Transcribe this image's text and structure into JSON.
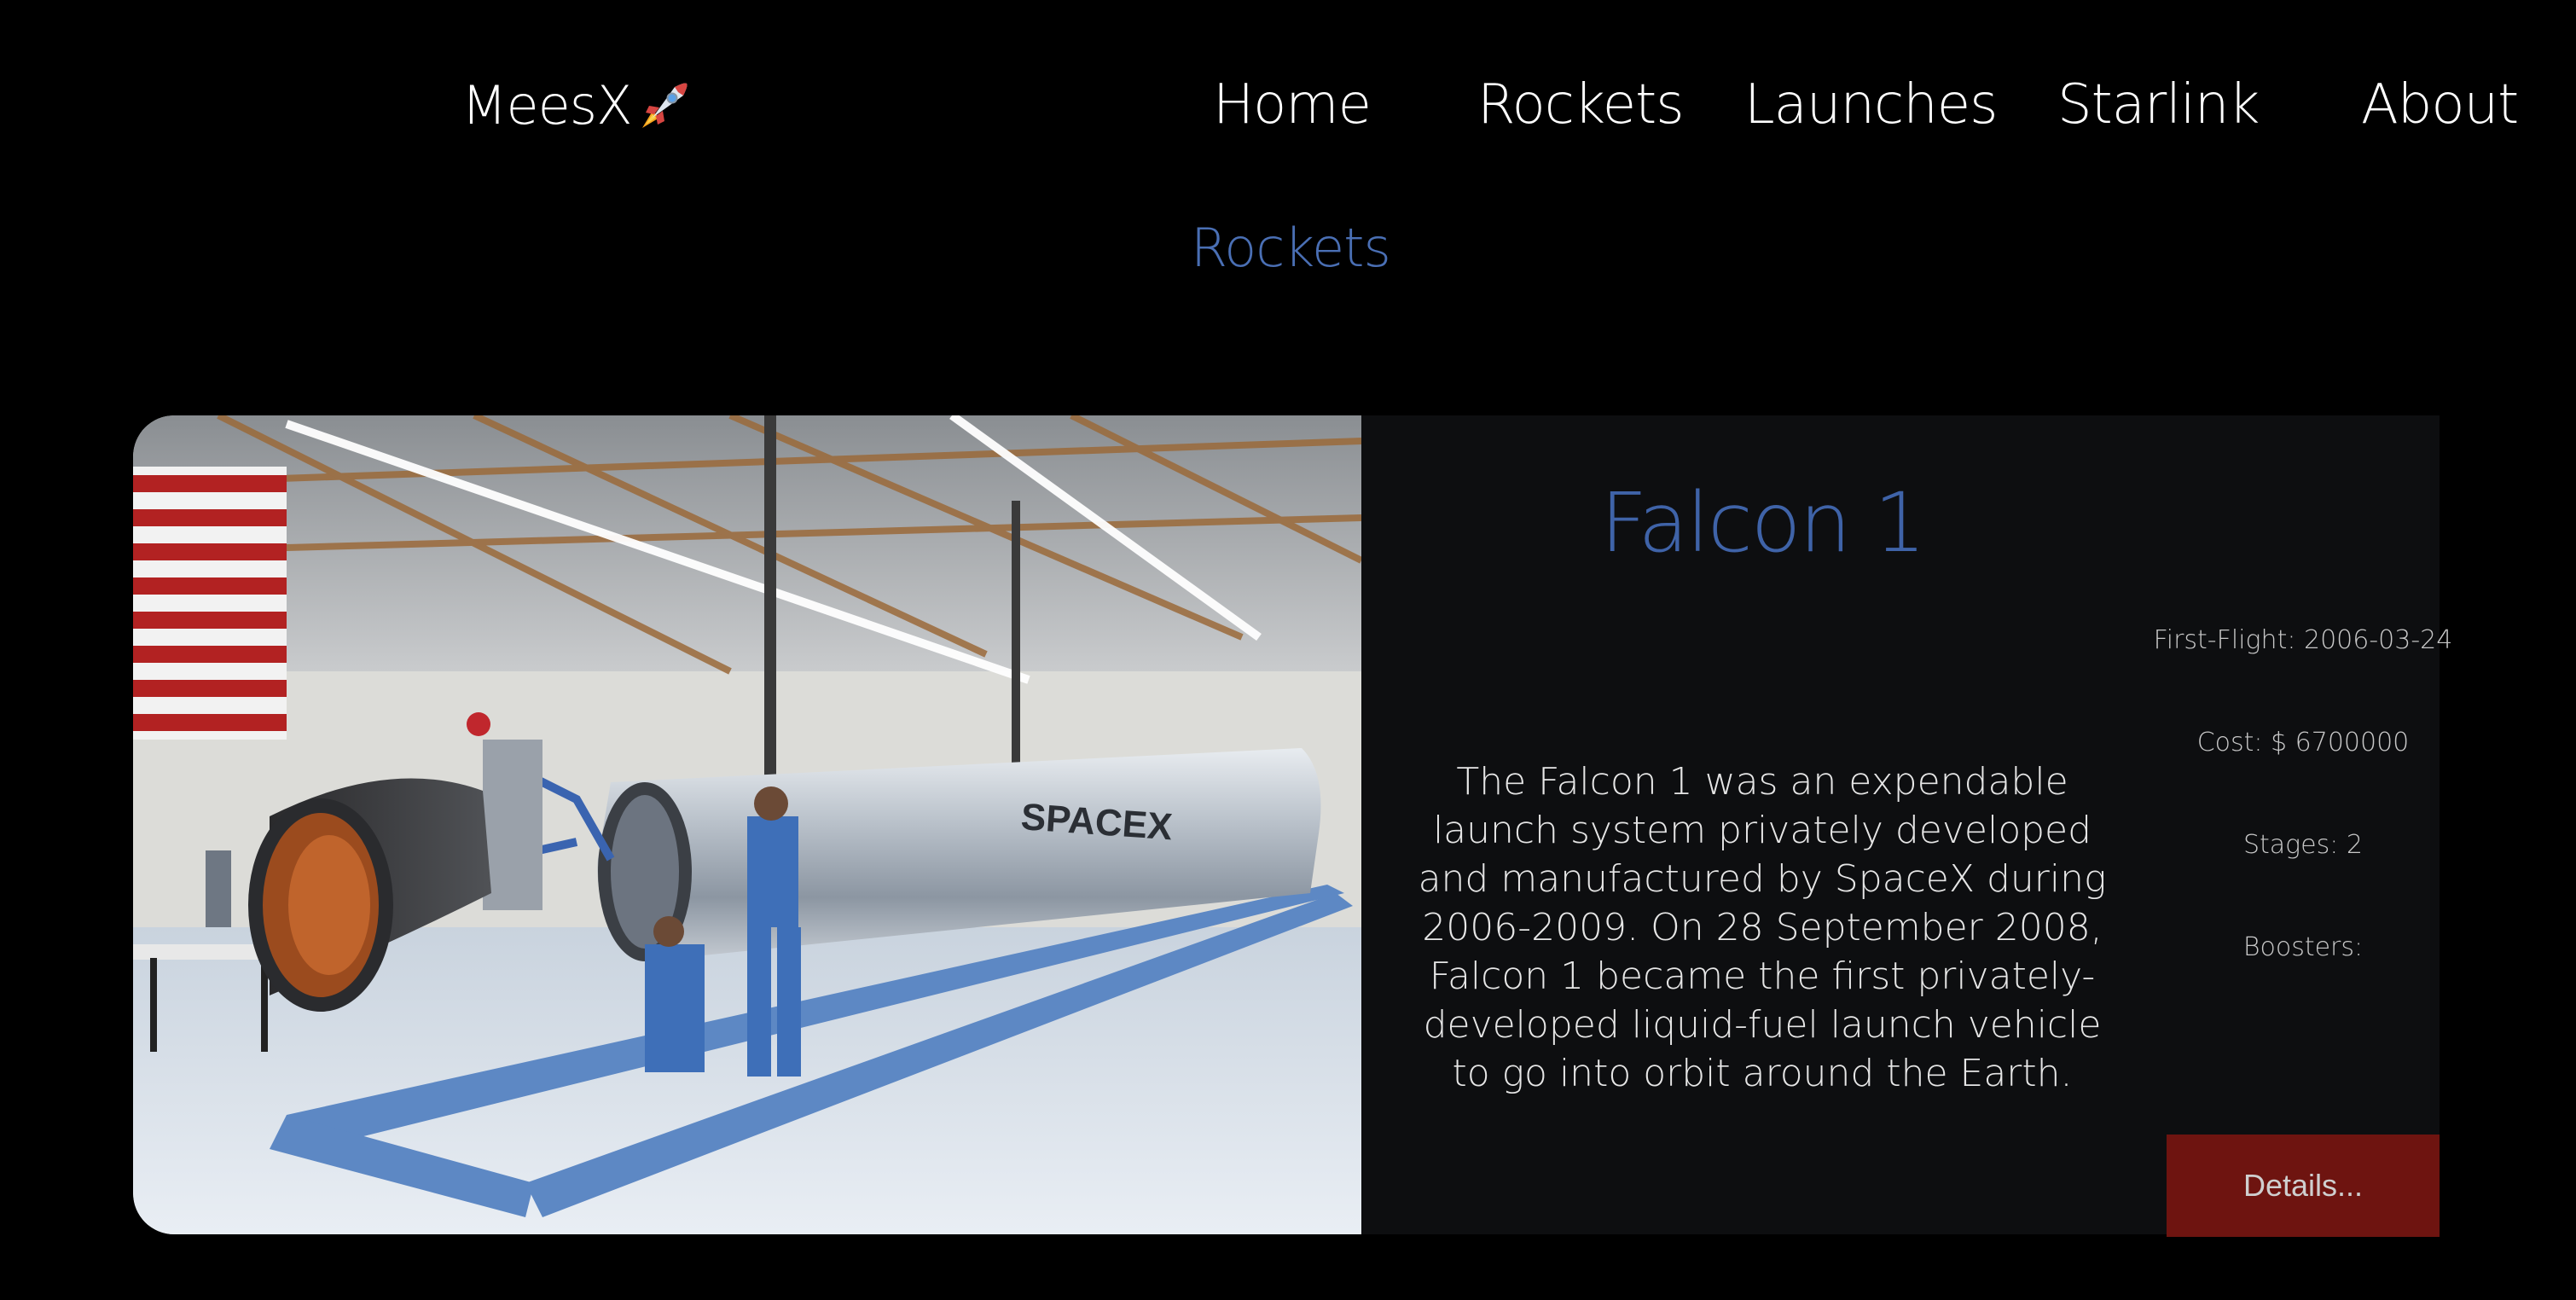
{
  "nav": {
    "brand": "MeesX",
    "brand_icon": "rocket-emoji-icon",
    "links": [
      "Home",
      "Rockets",
      "Launches",
      "Starlink",
      "About"
    ]
  },
  "section": {
    "title": "Rockets"
  },
  "rocket": {
    "name": "Falcon 1",
    "description": "The Falcon 1 was an expendable launch system privately developed and manufactured by SpaceX during 2006-2009. On 28 September 2008, Falcon 1 became the first privately-developed liquid-fuel launch vehicle to go into orbit around the Earth.",
    "first_flight": "First-Flight: 2006-03-24",
    "cost": "Cost: $ 6700000",
    "stages": "Stages: 2",
    "boosters": "Boosters:",
    "details_label": "Details...",
    "image_alt": "Falcon 1 rocket in hangar",
    "image_text": "SPACEX"
  },
  "colors": {
    "background": "#000000",
    "accent_blue": "#3f63a8",
    "card_bg": "#0d0e10",
    "button_red": "#6e1410"
  }
}
